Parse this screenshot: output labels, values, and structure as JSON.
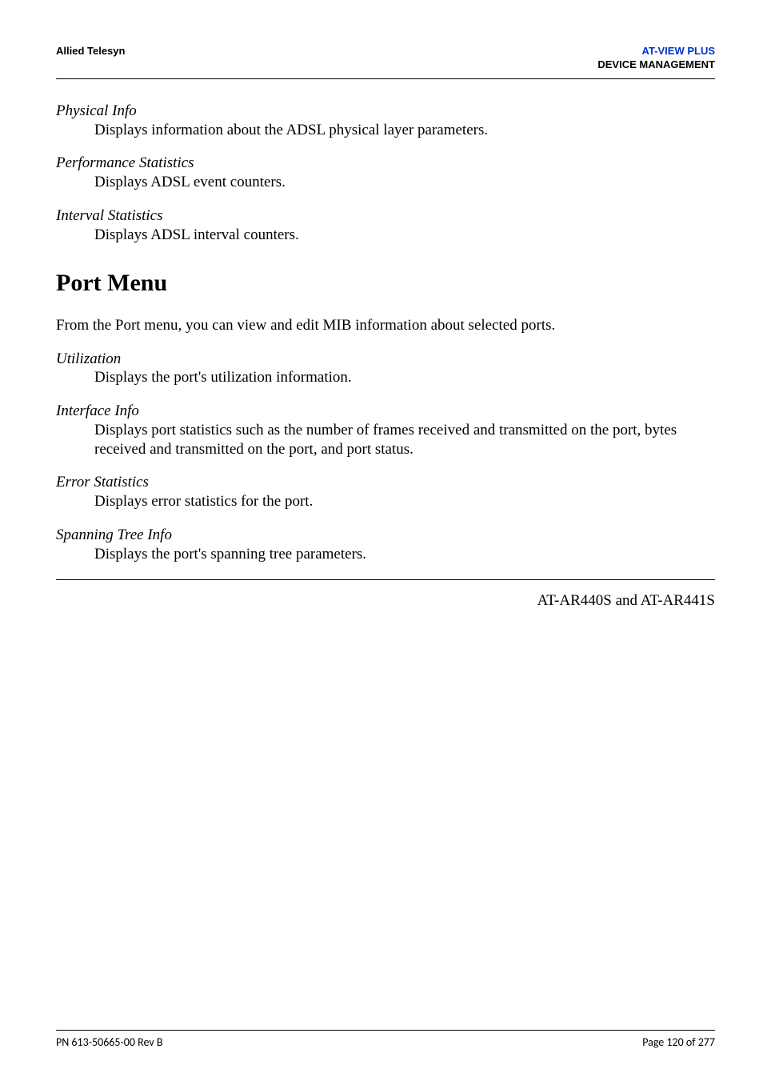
{
  "header": {
    "left": "Allied Telesyn",
    "right_blue": "AT-VIEW PLUS",
    "right_black": "DEVICE MANAGEMENT"
  },
  "defs_top": [
    {
      "term": "Physical Info",
      "desc": "Displays information about the ADSL physical layer parameters."
    },
    {
      "term": "Performance Statistics",
      "desc": "Displays ADSL event counters."
    },
    {
      "term": "Interval Statistics",
      "desc": "Displays ADSL interval counters."
    }
  ],
  "section_heading": "Port Menu",
  "section_intro": "From the Port menu, you can view and edit MIB information about selected ports.",
  "defs_port": [
    {
      "term": "Utilization",
      "desc": "Displays the port's utilization information."
    },
    {
      "term": "Interface Info",
      "desc": "Displays port statistics such as the number of frames received and transmitted on the port, bytes received and transmitted on the port, and port status."
    },
    {
      "term": "Error Statistics",
      "desc": "Displays error statistics for the port."
    },
    {
      "term": "Spanning Tree Info",
      "desc": "Displays the port's spanning tree parameters."
    }
  ],
  "model_line": "AT-AR440S and AT-AR441S",
  "footer": {
    "left": "PN 613-50665-00 Rev B",
    "right": "Page 120 of 277"
  }
}
